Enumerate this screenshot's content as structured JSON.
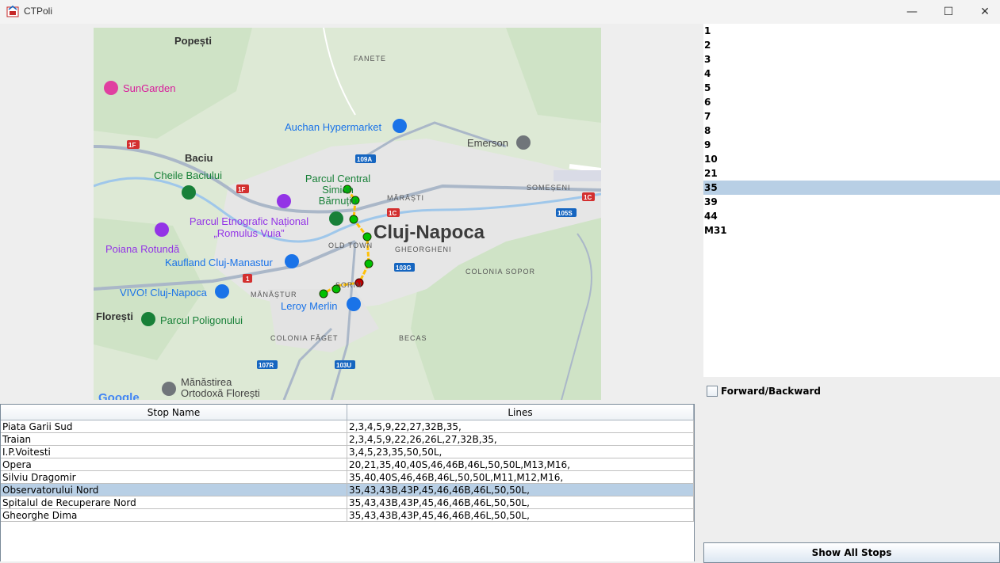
{
  "window": {
    "title": "CTPoli",
    "controls": {
      "minimize": "—",
      "maximize": "☐",
      "close": "✕"
    }
  },
  "map": {
    "city_label": "Cluj-Napoca",
    "town_labels": [
      "Popești",
      "Baciu",
      "Florești"
    ],
    "area_labels": [
      "FANETE",
      "MĂRĂȘTI",
      "SOMEȘENI",
      "OLD TOWN",
      "GHEORGHENI",
      "COLONIA SOPOR",
      "MĂNĂȘTUR",
      "COLONIA FĂGET",
      "BECAS",
      "SORIN"
    ],
    "road_labels": [
      "1F",
      "1F",
      "109A",
      "1C",
      "1C",
      "105S",
      "103G",
      "1",
      "107R",
      "103U"
    ],
    "pois": [
      {
        "label": "SunGarden",
        "icon": "camera-icon",
        "color": "#d81b9b"
      },
      {
        "label": "Auchan Hypermarket",
        "icon": "shopping-cart-icon",
        "color": "#1a73e8"
      },
      {
        "label": "Emerson",
        "icon": "place-icon",
        "color": "#70757a"
      },
      {
        "label": "Cheile Baciului",
        "icon": "tree-icon",
        "color": "#188038"
      },
      {
        "label": "Parcul Central Simion Bărnuțiu",
        "icon": "tree-icon",
        "color": "#188038"
      },
      {
        "label": "Parcul Etnografic Național „Romulus Vuia”",
        "icon": "museum-icon",
        "color": "#9334e6"
      },
      {
        "label": "Poiana Rotundă",
        "icon": "camera-icon",
        "color": "#9334e6"
      },
      {
        "label": "Kaufland Cluj-Manastur",
        "icon": "shopping-cart-icon",
        "color": "#1a73e8"
      },
      {
        "label": "VIVO! Cluj-Napoca",
        "icon": "shopping-bag-icon",
        "color": "#1a73e8"
      },
      {
        "label": "Leroy Merlin",
        "icon": "shopping-bag-icon",
        "color": "#1a73e8"
      },
      {
        "label": "Parcul Poligonului",
        "icon": "tree-icon",
        "color": "#188038"
      },
      {
        "label": "Mănăstirea Ortodoxă Florești",
        "icon": "church-icon",
        "color": "#444444"
      }
    ],
    "attribution": "Google",
    "route_color": "#ffc107",
    "stop_color": "#00c000",
    "selected_stop_color": "#c00000"
  },
  "routes_list": {
    "items": [
      "1",
      "2",
      "3",
      "4",
      "5",
      "6",
      "7",
      "8",
      "9",
      "10",
      "21",
      "35",
      "39",
      "44",
      "M31"
    ],
    "selected": "35"
  },
  "direction_toggle": {
    "label": "Forward/Backward",
    "checked": false
  },
  "show_all_button": {
    "label": "Show All Stops"
  },
  "stops_table": {
    "headers": [
      "Stop Name",
      "Lines"
    ],
    "rows": [
      {
        "name": "Piata Garii Sud",
        "lines": "2,3,4,5,9,22,27,32B,35,"
      },
      {
        "name": "Traian",
        "lines": "2,3,4,5,9,22,26,26L,27,32B,35,"
      },
      {
        "name": "I.P.Voitesti",
        "lines": "3,4,5,23,35,50,50L,"
      },
      {
        "name": "Opera",
        "lines": "20,21,35,40,40S,46,46B,46L,50,50L,M13,M16,"
      },
      {
        "name": "Silviu Dragomir",
        "lines": "35,40,40S,46,46B,46L,50,50L,M11,M12,M16,"
      },
      {
        "name": "Observatorului Nord",
        "lines": "35,43,43B,43P,45,46,46B,46L,50,50L,"
      },
      {
        "name": "Spitalul de Recuperare Nord",
        "lines": "35,43,43B,43P,45,46,46B,46L,50,50L,"
      },
      {
        "name": "Gheorghe Dima",
        "lines": "35,43,43B,43P,45,46,46B,46L,50,50L,"
      }
    ],
    "selected_row": 5
  }
}
